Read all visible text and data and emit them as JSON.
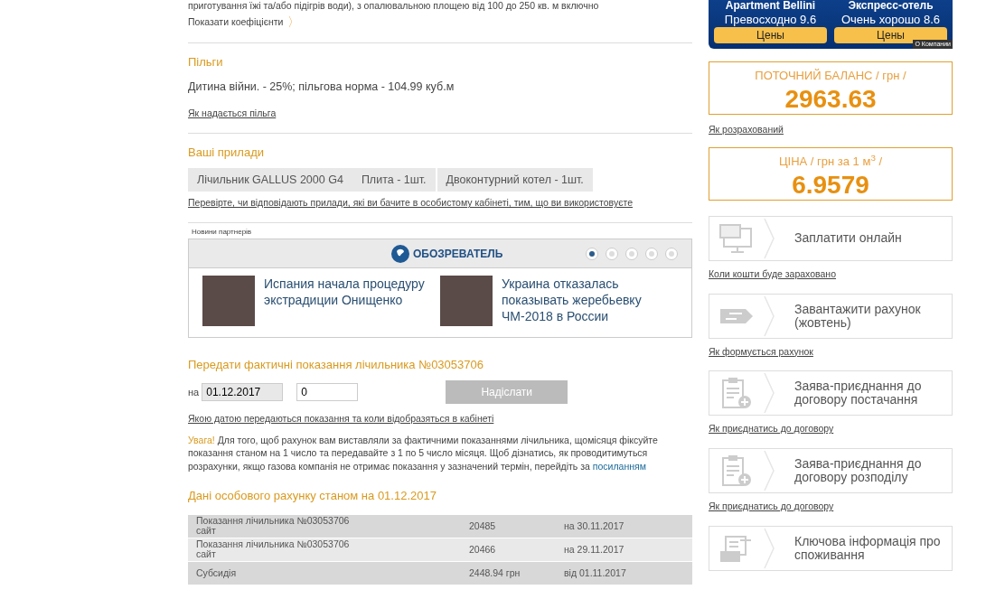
{
  "intro": {
    "text": "приготування їжі та/або підігрів води), з опалювальною площею від 100 до 250 кв. м включно",
    "link": "Показати коефіцієнти",
    "arrow": "〉"
  },
  "benefits": {
    "title": "Пільги",
    "text": "Дитина війни. - 25%; пільгова норма - 104.99 куб.м",
    "link": "Як надається пільга"
  },
  "devices": {
    "title": "Ваші прилади",
    "items": [
      "Лічильник GALLUS 2000 G4",
      "Плита - 1шт.",
      "Двоконтурний котел - 1шт."
    ],
    "link": "Перевірте, чи відповідають прилади, які ви бачите в особистому кабінеті, тим, що ви використовуєте"
  },
  "partner_news": {
    "label": "Новини партнерів",
    "logo": "ОБОЗРЕВАТЕЛЬ",
    "dots": [
      {
        "selected": true
      },
      {
        "selected": false
      },
      {
        "selected": false
      },
      {
        "selected": false
      },
      {
        "selected": false
      }
    ],
    "articles": [
      {
        "title": "Испания начала процедуру экстрадиции Онищенко"
      },
      {
        "title": "Украина отказалась показывать жеребьевку ЧМ-2018 в России"
      }
    ]
  },
  "meter_form": {
    "title": "Передати фактичні показання лічильника №03053706",
    "on_label": "на",
    "date": "01.12.2017",
    "value": "0",
    "submit": "Надіслати",
    "submit_disabled": true,
    "link": "Якою датою передаються показання та коли відобразяться в кабінеті",
    "notice": "**Увага!** Для того, щоб рахунок вам виставляли за фактичними показаннями лічильника, щомісяця фіксуйте показання станом на 1 число та передавайте з 1 по 5 число місяця. Щоб дізнатись, як проводитимуться розрахунки, якщо газова компанія не отримає показання у зазначений термін, перейдіть за",
    "notice_link": "посиланням"
  },
  "account": {
    "title": "Дані особового рахунку станом на 01.12.2017",
    "rows": [
      {
        "label": "Показання лічильника №03053706",
        "sub": "сайт",
        "value": "20485",
        "date": "на 30.11.2017"
      },
      {
        "label": "Показання лічильника №03053706",
        "sub": "сайт",
        "value": "20466",
        "date": "на 29.11.2017"
      },
      {
        "label": "Субсидія",
        "value": "2448.94 грн",
        "date": "від 01.11.2017"
      }
    ]
  },
  "ad": {
    "hotels": [
      {
        "name": "Apartment Bellini",
        "rating": "Превосходно 9.6",
        "button": "Цены"
      },
      {
        "name": "Экспресс-отель",
        "rating": "Очень хорошо 8.6",
        "button": "Цены"
      }
    ],
    "tag": "О Компании"
  },
  "balance": {
    "label": "ПОТОЧНИЙ БАЛАНС / грн /",
    "value": "2963.63",
    "link": "Як розрахований"
  },
  "price": {
    "label": "ЦІНА / грн за 1 м$^{3}$ /",
    "value": "6.9579"
  },
  "actions": [
    {
      "label": "Заплатити онлайн",
      "link": "Коли кошти буде зараховано"
    },
    {
      "label": "Завантажити рахунок (жовтень)",
      "link": "Як формується рахунок"
    },
    {
      "label": "Заява-приєднання до договору постачання",
      "link": "Як приєднатись до договору"
    },
    {
      "label": "Заява-приєднання до договору розподілу",
      "link": "Як приєднатись до договору"
    },
    {
      "label": "Ключова інформація про споживання"
    }
  ]
}
